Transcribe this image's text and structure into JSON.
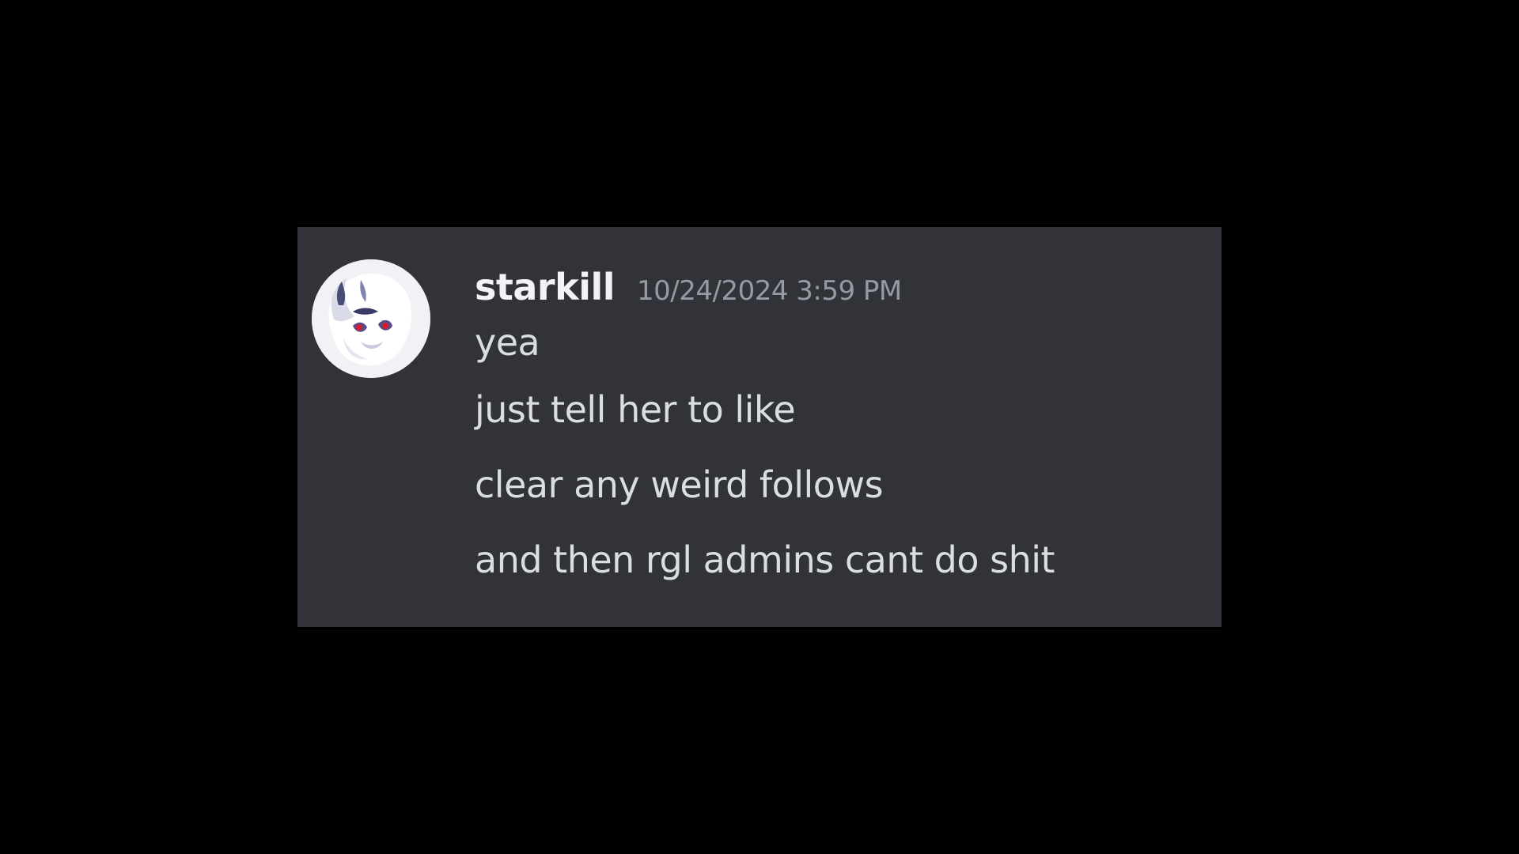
{
  "message": {
    "author": "starkill",
    "timestamp": "10/24/2024 3:59 PM",
    "avatar_icon": "white-creature-avatar-icon",
    "lines": [
      "yea",
      "just tell her to like",
      "clear any weird follows",
      "and then rgl admins cant do shit"
    ]
  },
  "colors": {
    "page_background": "#000000",
    "card_background": "#313338",
    "username": "#f2f3f5",
    "timestamp": "#949ba4",
    "message_text": "#dbdee1"
  }
}
